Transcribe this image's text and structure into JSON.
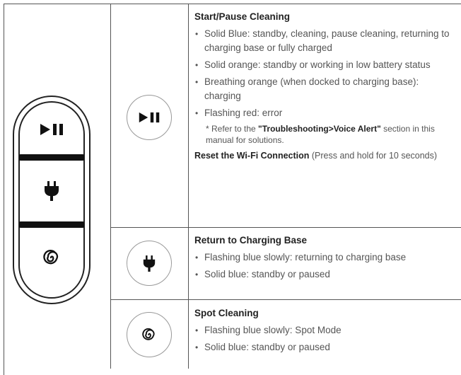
{
  "icons": {
    "play_pause": "play-pause-icon",
    "plug": "plug-icon",
    "spiral": "spiral-icon"
  },
  "rows": [
    {
      "title": "Start/Pause Cleaning",
      "bullets": [
        "Solid Blue: standby, cleaning, pause cleaning, returning to charging base or fully charged",
        "Solid orange: standby or working in low battery status",
        "Breathing orange (when docked to charging base): charging",
        "Flashing red: error"
      ],
      "note_prefix": "* Refer to the ",
      "note_bold": "\"Troubleshooting>Voice Alert\"",
      "note_suffix": " section in this manual for solutions.",
      "reset_bold": "Reset the Wi-Fi Connection",
      "reset_text": " (Press and hold for 10 seconds)"
    },
    {
      "title": "Return to Charging Base",
      "bullets": [
        "Flashing blue slowly: returning to charging base",
        "Solid blue: standby or paused"
      ]
    },
    {
      "title": "Spot Cleaning",
      "bullets": [
        "Flashing blue slowly: Spot Mode",
        "Solid blue: standby or paused"
      ]
    }
  ]
}
